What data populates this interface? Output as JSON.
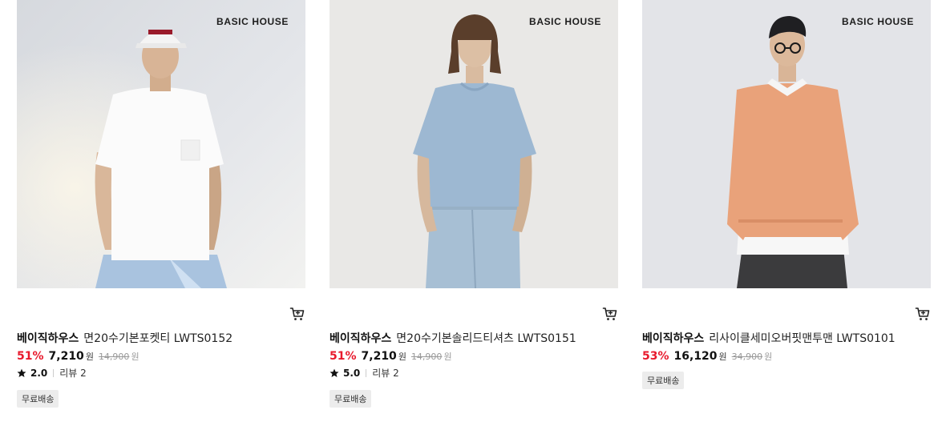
{
  "products": [
    {
      "image_brand": "BASIC HOUSE",
      "brand": "베이직하우스",
      "name": "면20수기본포켓티 LWTS0152",
      "discount": "51%",
      "price": "7,210",
      "currency": "원",
      "original_price": "14,900",
      "rating": "2.0",
      "review_label": "리뷰 2",
      "badge": "무료배송",
      "has_rating": true
    },
    {
      "image_brand": "BASIC HOUSE",
      "brand": "베이직하우스",
      "name": "면20수기본솔리드티셔츠 LWTS0151",
      "discount": "51%",
      "price": "7,210",
      "currency": "원",
      "original_price": "14,900",
      "rating": "5.0",
      "review_label": "리뷰 2",
      "badge": "무료배송",
      "has_rating": true
    },
    {
      "image_brand": "BASIC HOUSE",
      "brand": "베이직하우스",
      "name": "리사이클세미오버핏맨투맨 LWTS0101",
      "discount": "53%",
      "price": "16,120",
      "currency": "원",
      "original_price": "34,900",
      "badge": "무료배송",
      "has_rating": false
    }
  ],
  "icons": {
    "cart": "cart-icon",
    "star": "star-icon"
  },
  "colors": {
    "discount": "#e8192c",
    "badge_bg": "#ececec"
  }
}
